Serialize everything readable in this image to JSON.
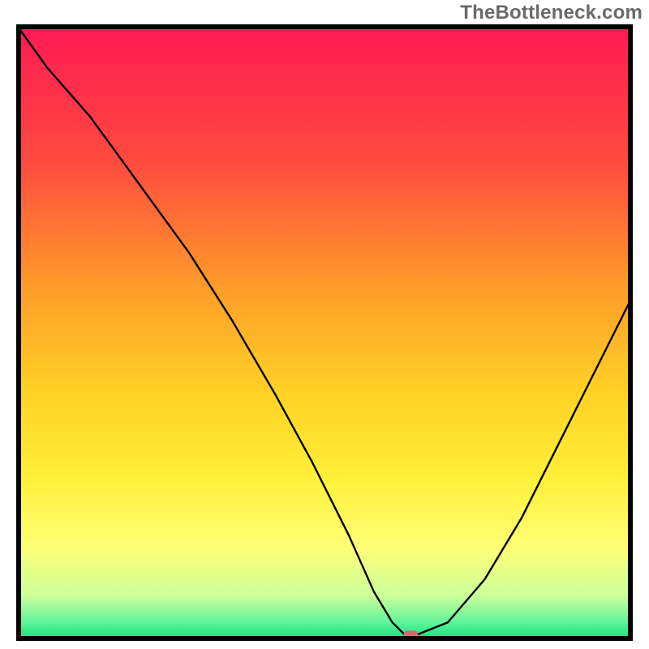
{
  "watermark": "TheBottleneck.com",
  "chart_data": {
    "type": "line",
    "title": "",
    "xlabel": "",
    "ylabel": "",
    "xlim": [
      0,
      100
    ],
    "ylim": [
      0,
      100
    ],
    "grid": false,
    "legend": false,
    "background_gradient": {
      "stops": [
        {
          "pos": 0.0,
          "color": "#ff1a55"
        },
        {
          "pos": 0.22,
          "color": "#ff4a3f"
        },
        {
          "pos": 0.42,
          "color": "#ff9a2a"
        },
        {
          "pos": 0.6,
          "color": "#ffd225"
        },
        {
          "pos": 0.74,
          "color": "#fff03a"
        },
        {
          "pos": 0.85,
          "color": "#ffff76"
        },
        {
          "pos": 0.93,
          "color": "#ccff9a"
        },
        {
          "pos": 0.975,
          "color": "#5cf39a"
        },
        {
          "pos": 1.0,
          "color": "#18e07a"
        }
      ]
    },
    "series": [
      {
        "name": "bottleneck-curve",
        "color": "#000000",
        "stroke_width": 2.4,
        "x": [
          0,
          5,
          12,
          20,
          28,
          35,
          42,
          48,
          54,
          58,
          61,
          63,
          65,
          70,
          76,
          82,
          88,
          94,
          100
        ],
        "y": [
          100,
          93,
          85,
          74,
          63,
          52,
          40,
          29,
          17,
          8,
          3,
          1,
          1,
          3,
          10,
          20,
          32,
          44,
          56
        ]
      }
    ],
    "marker": {
      "name": "optimal-point",
      "x": 64,
      "y": 1,
      "color": "#d46a6a",
      "rx": 9,
      "ry": 5
    },
    "frame_color": "#000000",
    "frame_stroke": 6
  }
}
